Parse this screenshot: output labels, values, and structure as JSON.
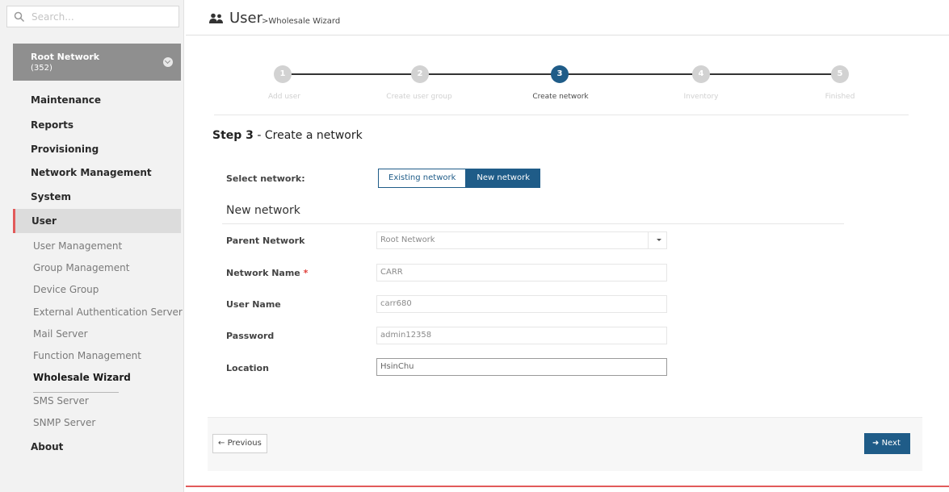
{
  "sidebar": {
    "search_placeholder": "Search...",
    "network": {
      "name": "Root Network",
      "count": "(352)"
    },
    "menu": [
      "Maintenance",
      "Reports",
      "Provisioning",
      "Network Management",
      "System"
    ],
    "active_menu": "User",
    "submenu": [
      "User Management",
      "Group Management",
      "Device Group",
      "External Authentication Server",
      "Mail Server",
      "Function Management",
      "Wholesale Wizard",
      "SMS Server",
      "SNMP Server"
    ],
    "current_submenu": "Wholesale Wizard",
    "about": "About"
  },
  "header": {
    "title": "User",
    "breadcrumb": ">Wholesale Wizard"
  },
  "stepper": {
    "steps": [
      {
        "num": "1",
        "label": "Add user"
      },
      {
        "num": "2",
        "label": "Create user group"
      },
      {
        "num": "3",
        "label": "Create network"
      },
      {
        "num": "4",
        "label": "Inventory"
      },
      {
        "num": "5",
        "label": "Finished"
      }
    ],
    "current": 3
  },
  "form": {
    "step_prefix": "Step 3",
    "step_title": " - Create a network",
    "select_network_label": "Select network:",
    "existing_network": "Existing network",
    "new_network": "New network",
    "section_title": "New network",
    "parent_network_label": "Parent Network",
    "parent_network_value": "Root Network",
    "network_name_label": "Network Name",
    "network_name_value": "CARR",
    "user_name_label": "User Name",
    "user_name_value": "carr680",
    "password_label": "Password",
    "password_value": "admin12358",
    "location_label": "Location",
    "location_value": "HsinChu"
  },
  "buttons": {
    "previous": "Previous",
    "next": "Next"
  },
  "colors": {
    "accent": "#1f5c88",
    "active_marker": "#e25a5a"
  }
}
